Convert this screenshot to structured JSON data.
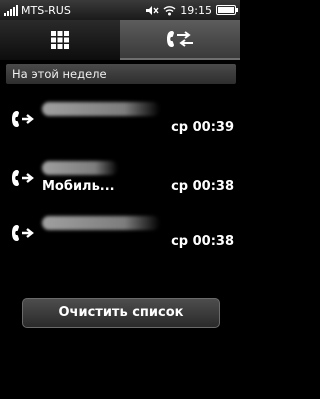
{
  "status": {
    "operator": "MTS-RUS",
    "time": "19:15",
    "icons": [
      "signal-icon",
      "mute-icon",
      "wifi-icon",
      "battery-icon"
    ]
  },
  "tabs": [
    {
      "icon": "dialpad-icon",
      "selected": false
    },
    {
      "icon": "call-log-icon",
      "selected": true
    }
  ],
  "section_header": "На этой неделе",
  "calls": [
    {
      "icon": "outgoing-call-icon",
      "type": "",
      "time": "ср 00:39"
    },
    {
      "icon": "outgoing-call-icon",
      "type": "Мобиль...",
      "time": "ср 00:38"
    },
    {
      "icon": "outgoing-call-icon",
      "type": "",
      "time": "ср 00:38"
    }
  ],
  "clear_button": "Очистить список",
  "colors": {
    "background": "#000000",
    "text": "#ffffff",
    "header_bg": "#3a3a3a"
  }
}
